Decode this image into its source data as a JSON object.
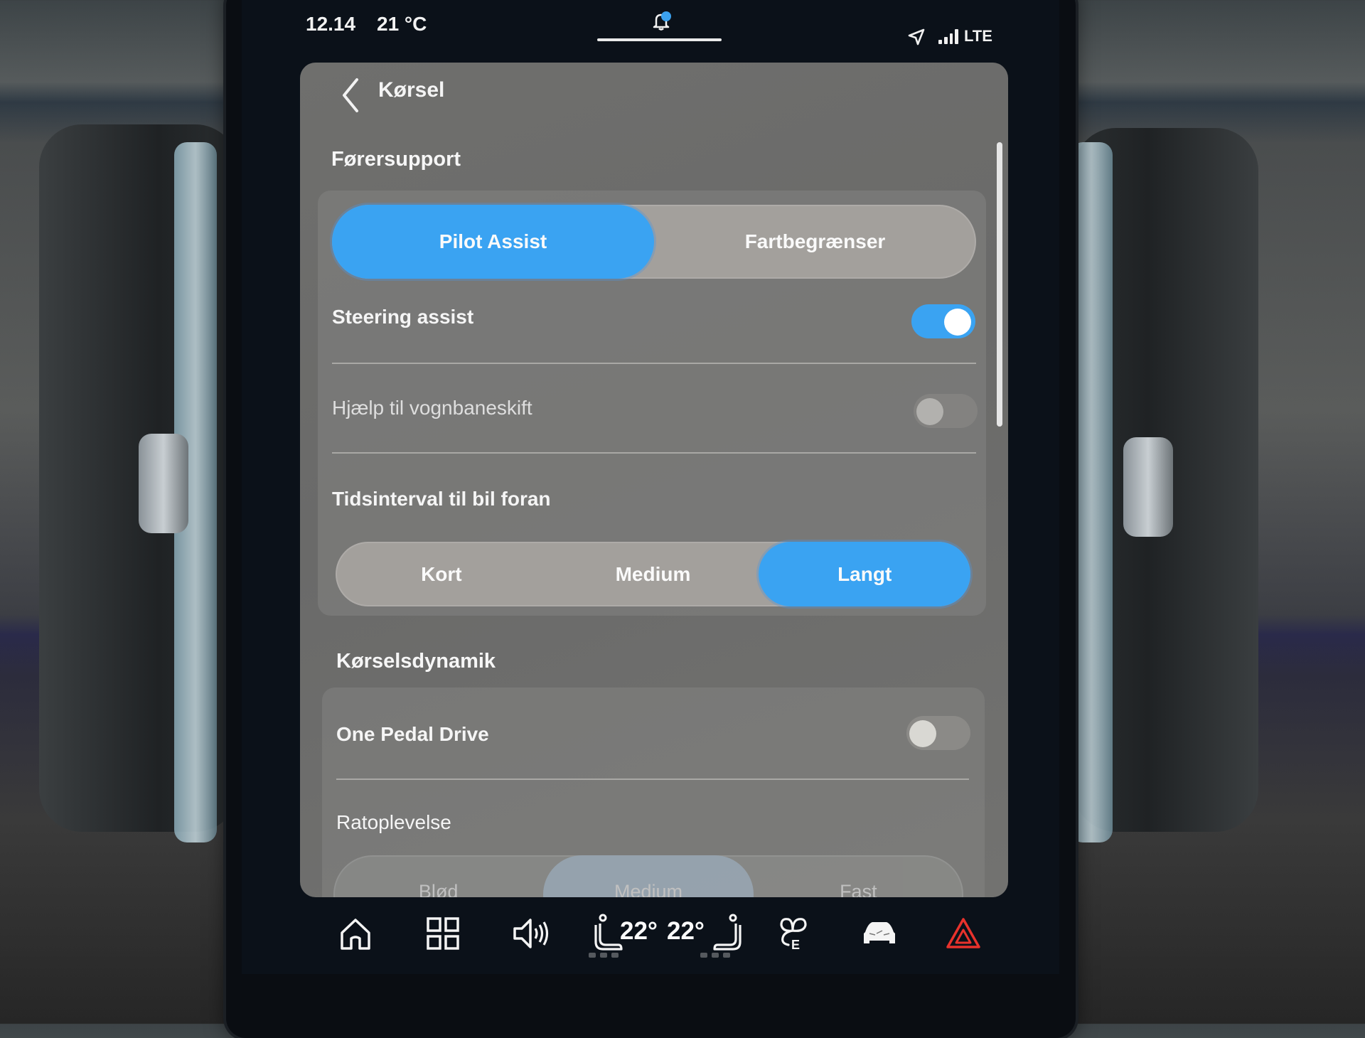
{
  "status_bar": {
    "time": "12.14",
    "temperature": "21 °C",
    "network": "LTE",
    "notification_badge": true,
    "icons": [
      "bell-icon",
      "location-arrow-icon",
      "signal-bars-icon"
    ]
  },
  "header": {
    "back_icon": "chevron-left-icon",
    "title": "Kørsel"
  },
  "sections": [
    {
      "heading": "Førersupport",
      "mode_selector": {
        "options": [
          "Pilot Assist",
          "Fartbegrænser"
        ],
        "selected": "Pilot Assist"
      },
      "rows": [
        {
          "label": "Steering assist",
          "type": "toggle",
          "value": true
        },
        {
          "label": "Hjælp til vognbaneskift",
          "type": "toggle",
          "value": false,
          "disabled": true
        },
        {
          "label": "Tidsinterval til bil foran",
          "type": "segmented",
          "options": [
            "Kort",
            "Medium",
            "Langt"
          ],
          "selected": "Langt"
        }
      ]
    },
    {
      "heading": "Kørselsdynamik",
      "rows": [
        {
          "label": "One Pedal Drive",
          "type": "toggle",
          "value": false
        },
        {
          "label": "Ratoplevelse",
          "type": "segmented",
          "options": [
            "Blød",
            "Medium",
            "Fast"
          ],
          "selected": "Medium"
        }
      ]
    }
  ],
  "dock": {
    "items": [
      {
        "name": "home",
        "icon": "home-icon"
      },
      {
        "name": "apps",
        "icon": "app-grid-icon"
      },
      {
        "name": "volume",
        "icon": "speaker-icon"
      },
      {
        "name": "climate-driver",
        "icon": "seat-heat-left-icon",
        "temperature": "22°"
      },
      {
        "name": "climate-passenger",
        "icon": "seat-heat-right-icon",
        "temperature": "22°"
      },
      {
        "name": "fan",
        "icon": "fan-eco-icon"
      },
      {
        "name": "car",
        "icon": "car-icon"
      },
      {
        "name": "hazard",
        "icon": "hazard-triangle-icon"
      }
    ]
  },
  "colors": {
    "accent": "#3aa3f2",
    "hazard": "#e8322c",
    "panel": "#6e6e6c"
  }
}
